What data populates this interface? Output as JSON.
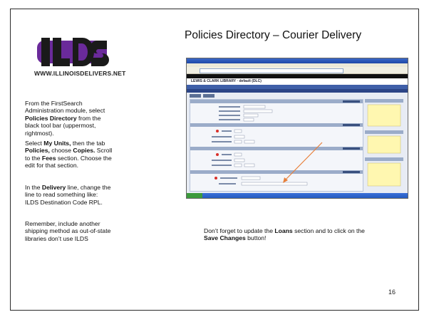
{
  "slide": {
    "title": "Policies Directory – Courier Delivery",
    "page_number": "16"
  },
  "logo": {
    "text": "ILDS",
    "url_text": "WWW.ILLINOISDELIVERS.NET",
    "colors": {
      "dark": "#1a1a1a",
      "purple": "#6a2a9a"
    }
  },
  "instructions": {
    "p1": {
      "a": "From the FirstSearch Administration module, select ",
      "b": "Policies Directory",
      "c": " from  the black tool bar (uppermost, rightmost)."
    },
    "p2": {
      "a": "Select ",
      "b": "My Units,",
      "c": " then the tab ",
      "d": "Policies,",
      "e": " choose ",
      "f": "Copies.",
      "g": " Scroll to the ",
      "h": "Fees",
      "i": " section. Choose the edit for that section."
    },
    "p3": {
      "a": "In the ",
      "b": "Delivery",
      "c": " line, change the line to read something like:",
      "d": "ILDS Destination Code RPL."
    },
    "p4": {
      "a": "Remember, include another shipping method as out-of-state libraries don’t use ILDS"
    }
  },
  "caption": {
    "a": "Don’t forget to update the ",
    "b": "Loans",
    "c": " section and to click on the ",
    "d": "Save Changes",
    "e": " button!"
  },
  "screenshot": {
    "brand": "LEWIS & CLARK LIBRARY · default (DLC)",
    "arrow_color": "#e8803a",
    "highlight_color": "#d9302a",
    "note_color": "#fff7b0"
  }
}
